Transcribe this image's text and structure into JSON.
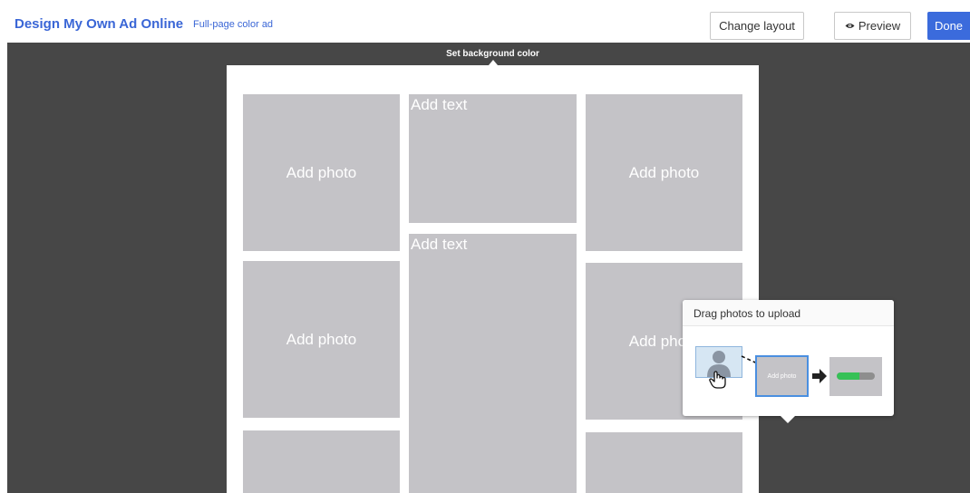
{
  "header": {
    "title": "Design My Own Ad Online",
    "subtitle": "Full-page color ad",
    "change_layout_label": "Change layout",
    "preview_label": "Preview",
    "preview_icon": "eye-icon",
    "done_label": "Done"
  },
  "canvas": {
    "background_color_label": "Set background color",
    "slots": [
      {
        "kind": "photo",
        "label": "Add photo"
      },
      {
        "kind": "text",
        "label": "Add text"
      },
      {
        "kind": "photo",
        "label": "Add photo"
      },
      {
        "kind": "text",
        "label": "Add text"
      },
      {
        "kind": "photo",
        "label": "Add photo"
      },
      {
        "kind": "photo",
        "label": "Add photo"
      },
      {
        "kind": "photo",
        "label": ""
      },
      {
        "kind": "photo",
        "label": ""
      }
    ]
  },
  "upload_popup": {
    "title": "Drag photos to upload",
    "demo_slot_label": "Add photo",
    "demo_progress": 0.6,
    "icons": [
      "person-photo-icon",
      "hand-cursor-icon",
      "arrow-right-icon"
    ]
  },
  "colors": {
    "brand_blue": "#3a66d6",
    "done_button": "#3b6bdc",
    "canvas_dark": "#474747",
    "slot_gray": "#c4c3c7",
    "progress_green": "#36c157"
  }
}
